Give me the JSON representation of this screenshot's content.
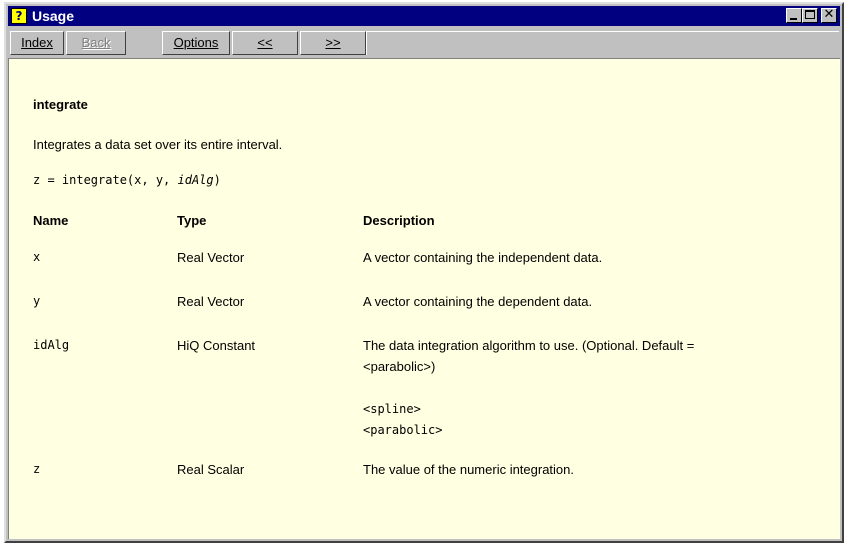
{
  "window": {
    "title": "Usage",
    "help_icon_glyph": "?",
    "close_glyph": "✕"
  },
  "toolbar": {
    "index_label": "Index",
    "back_label": "Back",
    "options_label": "Options",
    "prev_label": "<<",
    "next_label": ">>"
  },
  "topic": {
    "title": "integrate",
    "summary": "Integrates a data set over its entire interval.",
    "syntax_prefix": "z = integrate(x, y, ",
    "syntax_italic": "idAlg",
    "syntax_suffix": ")"
  },
  "table": {
    "headers": {
      "name": "Name",
      "type": "Type",
      "description": "Description"
    },
    "rows": [
      {
        "name": "x",
        "type": "Real Vector",
        "description": "A vector containing the independent data."
      },
      {
        "name": "y",
        "type": "Real Vector",
        "description": "A vector containing the dependent data."
      },
      {
        "name": "idAlg",
        "type": "HiQ Constant",
        "description": "The data integration algorithm to use. (Optional. Default = <parabolic>)",
        "choices": [
          "<spline>",
          "<parabolic>"
        ]
      },
      {
        "name": "z",
        "type": "Real Scalar",
        "description": "The value of the numeric integration."
      }
    ]
  },
  "colors": {
    "titlebar": "#000080",
    "content_background": "#ffffe1",
    "chrome": "#c0c0c0"
  }
}
